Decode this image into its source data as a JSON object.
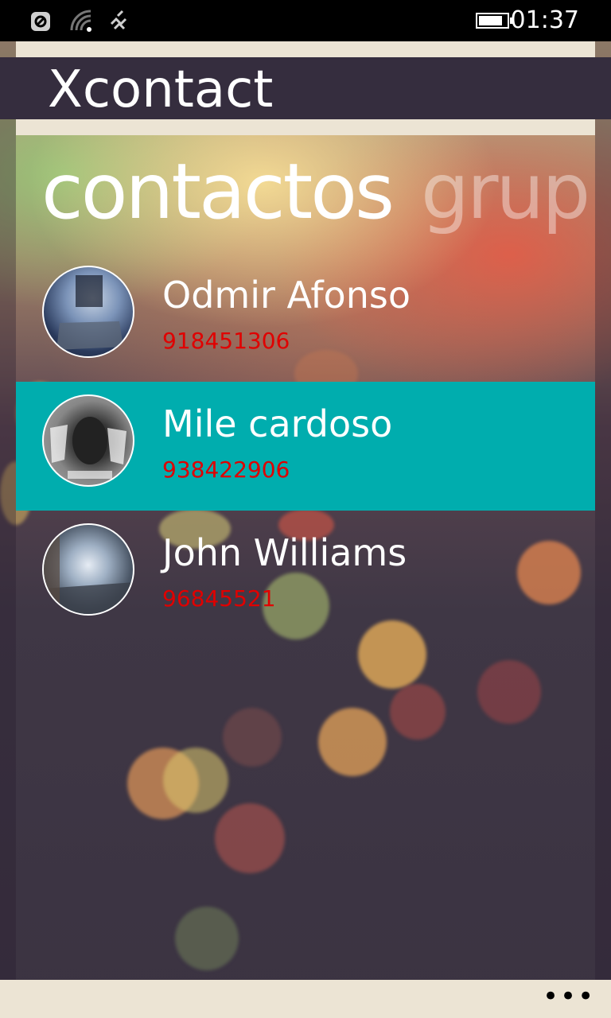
{
  "status_bar": {
    "time": "01:37",
    "battery_level": 0.85,
    "icons": [
      "data-sense-icon",
      "wifi-icon",
      "signal-icon"
    ]
  },
  "app": {
    "title": "Xcontact"
  },
  "pivot": {
    "active_label": "contactos",
    "next_label": "grup"
  },
  "contacts": [
    {
      "name": "Odmir Afonso",
      "phone": "918451306",
      "selected": false
    },
    {
      "name": "Mile cardoso",
      "phone": "938422906",
      "selected": true
    },
    {
      "name": "John Williams",
      "phone": "96845521",
      "selected": false
    }
  ],
  "app_bar": {
    "more_label": "•••"
  },
  "colors": {
    "header": "#352d3e",
    "selected_row": "#00adae",
    "phone_text": "#e00000",
    "band": "#ece4d4"
  }
}
